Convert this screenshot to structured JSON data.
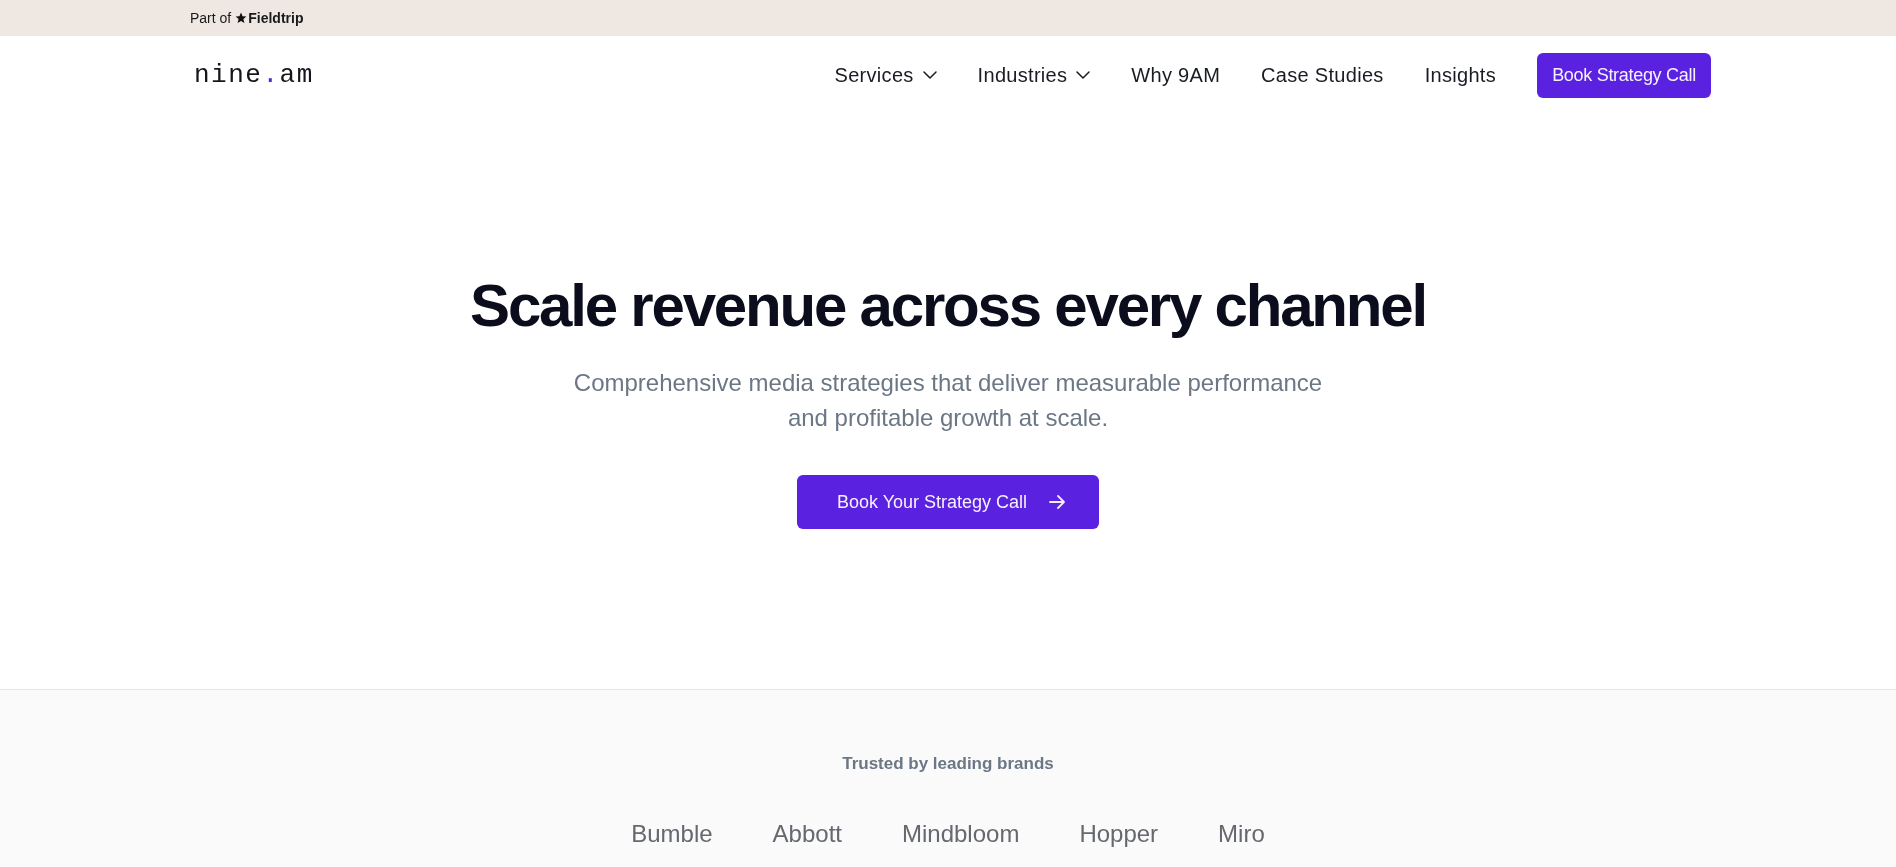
{
  "top_bar": {
    "prefix": "Part of",
    "brand": "Fieldtrip"
  },
  "header": {
    "logo": {
      "before": "nine",
      "accent": ".",
      "after": "am"
    },
    "nav": [
      {
        "label": "Services",
        "kind": "dropdown"
      },
      {
        "label": "Industries",
        "kind": "dropdown"
      },
      {
        "label": "Why 9AM",
        "kind": "link"
      },
      {
        "label": "Case Studies",
        "kind": "link"
      },
      {
        "label": "Insights",
        "kind": "link"
      }
    ],
    "cta": "Book Strategy Call"
  },
  "hero": {
    "title": "Scale revenue across every channel",
    "subtitle": "Comprehensive media strategies that deliver measurable performance and profitable growth at scale.",
    "button": "Book Your Strategy Call"
  },
  "brands": {
    "heading": "Trusted by leading brands",
    "items": [
      "Bumble",
      "Abbott",
      "Mindbloom",
      "Hopper",
      "Miro"
    ]
  }
}
